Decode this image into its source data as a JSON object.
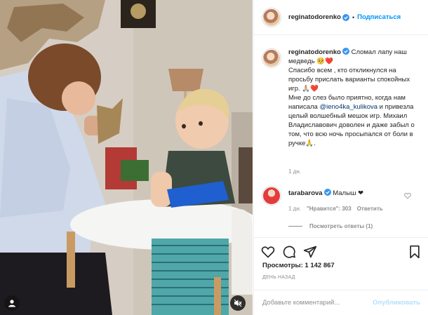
{
  "post": {
    "author": "reginatodorenko",
    "follow_label": "Подписаться",
    "dot": "•"
  },
  "caption": {
    "author": "reginatodorenko",
    "line1": "Сломал лапу наш медведь 🥺❤️",
    "line2": "Спасибо всем , кто откликнулся на просьбу прислать варианты спокойных игр. 🙏🏼❤️",
    "line3_before": "Мне до слез было приятно, когда нам написала ",
    "mention": "@ieno4ka_kulikova",
    "line3_after": " и привезла целый волшебный мешок игр. Михаил Владиславович доволен и даже забыл о том, что всю ночь просыпался от боли в ручке🙏.",
    "time": "1 дн."
  },
  "comment": {
    "author": "tarabarova",
    "text": "Малыш ❤",
    "time": "1 дн.",
    "likes": "\"Нравится\": 303",
    "reply_label": "Ответить",
    "view_replies": "Посмотреть ответы (1)"
  },
  "stats": {
    "views": "Просмотры: 1 142 867",
    "ago": "ДЕНЬ НАЗАД"
  },
  "add_comment": {
    "placeholder": "Добавьте комментарий...",
    "publish_label": "Опубликовать"
  },
  "icons": {
    "verified": "verified-badge-icon",
    "like": "heart-outline-icon",
    "comment": "comment-bubble-icon",
    "share": "paper-plane-icon",
    "save": "bookmark-icon",
    "user": "user-tag-icon",
    "mute": "speaker-muted-icon"
  },
  "colors": {
    "link_blue": "#0095f6",
    "mention": "#00376b",
    "muted": "#8e8e8e",
    "cast_blue": "#1f5fd0"
  }
}
